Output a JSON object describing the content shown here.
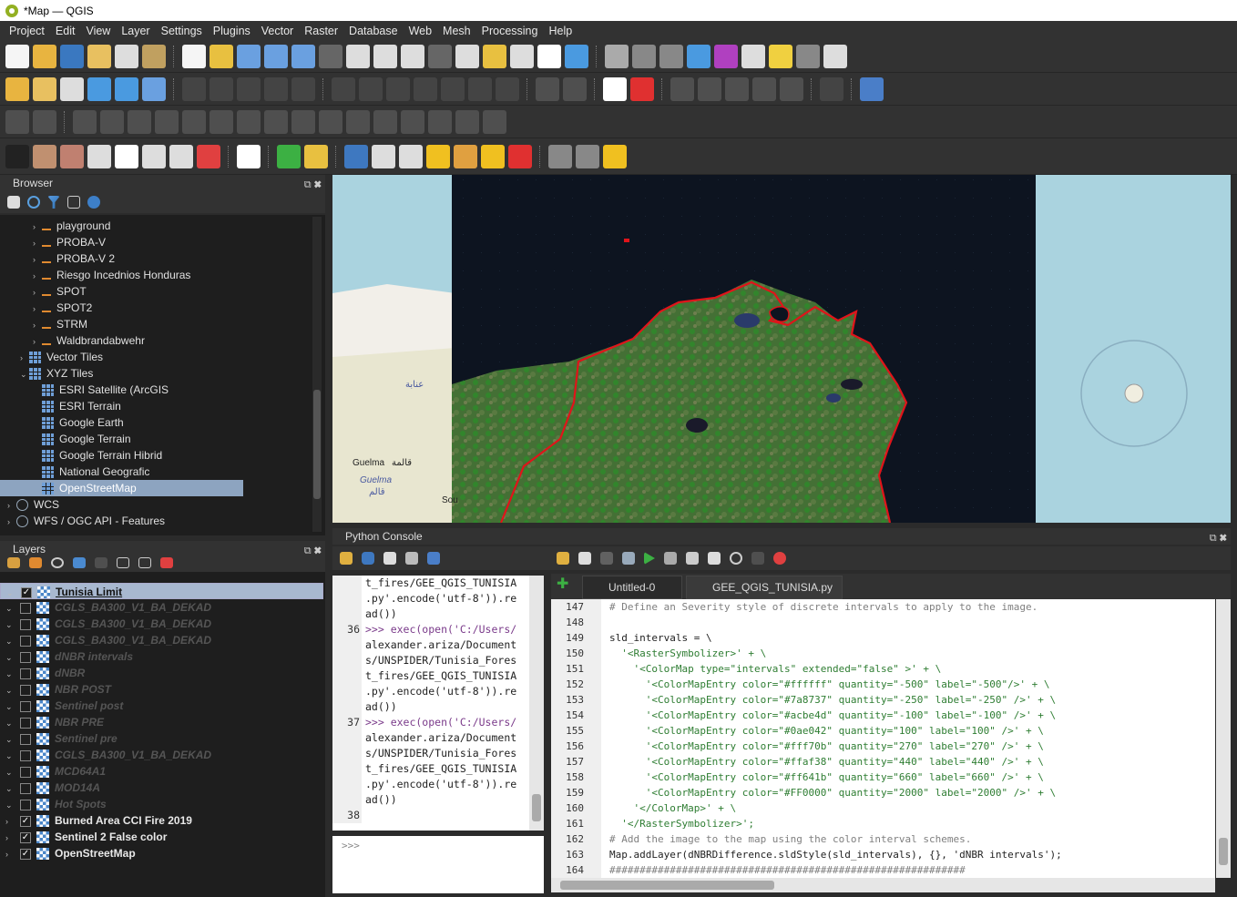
{
  "window": {
    "title": "*Map — QGIS"
  },
  "menu": [
    "Project",
    "Edit",
    "View",
    "Layer",
    "Settings",
    "Plugins",
    "Vector",
    "Raster",
    "Database",
    "Web",
    "Mesh",
    "Processing",
    "Help"
  ],
  "browser": {
    "title": "Browser",
    "items": [
      {
        "label": "playground",
        "kind": "conn",
        "indent": 2
      },
      {
        "label": "PROBA-V",
        "kind": "conn",
        "indent": 2
      },
      {
        "label": "PROBA-V 2",
        "kind": "conn",
        "indent": 2
      },
      {
        "label": "Riesgo Incednios Honduras",
        "kind": "conn",
        "indent": 2
      },
      {
        "label": "SPOT",
        "kind": "conn",
        "indent": 2
      },
      {
        "label": "SPOT2",
        "kind": "conn",
        "indent": 2
      },
      {
        "label": "STRM",
        "kind": "conn",
        "indent": 2
      },
      {
        "label": "Waldbrandabwehr",
        "kind": "conn",
        "indent": 2
      },
      {
        "label": "Vector Tiles",
        "kind": "grid",
        "indent": 1
      },
      {
        "label": "XYZ Tiles",
        "kind": "grid",
        "indent": 1,
        "expanded": true
      },
      {
        "label": "ESRI Satellite (ArcGIS",
        "kind": "grid",
        "indent": 2
      },
      {
        "label": "ESRI Terrain",
        "kind": "grid",
        "indent": 2
      },
      {
        "label": "Google Earth",
        "kind": "grid",
        "indent": 2
      },
      {
        "label": "Google Terrain",
        "kind": "grid",
        "indent": 2
      },
      {
        "label": "Google Terrain Hibrid",
        "kind": "grid",
        "indent": 2
      },
      {
        "label": "National Geografic",
        "kind": "grid",
        "indent": 2
      },
      {
        "label": "OpenStreetMap",
        "kind": "grid",
        "indent": 2,
        "selected": true
      },
      {
        "label": "WCS",
        "kind": "globe",
        "indent": 0
      },
      {
        "label": "WFS / OGC API - Features",
        "kind": "globe",
        "indent": 0
      }
    ]
  },
  "layers": {
    "title": "Layers",
    "items": [
      {
        "label": "Tunisia Limit",
        "checked": true,
        "selected": true,
        "bold": true
      },
      {
        "label": "CGLS_BA300_V1_BA_DEKAD",
        "checked": false
      },
      {
        "label": "CGLS_BA300_V1_BA_DEKAD",
        "checked": false
      },
      {
        "label": "CGLS_BA300_V1_BA_DEKAD",
        "checked": false
      },
      {
        "label": "dNBR intervals",
        "checked": false
      },
      {
        "label": "dNBR",
        "checked": false
      },
      {
        "label": "NBR POST",
        "checked": false
      },
      {
        "label": "Sentinel post",
        "checked": false
      },
      {
        "label": "NBR PRE",
        "checked": false
      },
      {
        "label": "Sentinel pre",
        "checked": false
      },
      {
        "label": "CGLS_BA300_V1_BA_DEKAD",
        "checked": false
      },
      {
        "label": "MCD64A1",
        "checked": false
      },
      {
        "label": "MOD14A",
        "checked": false
      },
      {
        "label": "Hot Spots",
        "checked": false
      },
      {
        "label": "Burned Area CCI Fire 2019",
        "checked": true,
        "bold": true
      },
      {
        "label": "Sentinel 2 False color",
        "checked": true,
        "bold": true
      },
      {
        "label": "OpenStreetMap",
        "checked": true,
        "bold": true
      }
    ]
  },
  "map": {
    "labels": {
      "guelma": "Guelma",
      "guelma_ar": "قالمة",
      "guelma2": "Guelma",
      "guelma2_ar": "قالم",
      "annaba_ar": "عنابة",
      "sou": "Sou"
    }
  },
  "python_console": {
    "title": "Python Console",
    "output": [
      {
        "n": "",
        "t": "t_fires/GEE_QGIS_TUNISIA"
      },
      {
        "n": "",
        "t": ".py'.encode('utf-8')).re"
      },
      {
        "n": "",
        "t": "ad())"
      },
      {
        "n": "36",
        "t": ">>> exec(open('C:/Users/"
      },
      {
        "n": "",
        "t": "alexander.ariza/Document"
      },
      {
        "n": "",
        "t": "s/UNSPIDER/Tunisia_Fores"
      },
      {
        "n": "",
        "t": "t_fires/GEE_QGIS_TUNISIA"
      },
      {
        "n": "",
        "t": ".py'.encode('utf-8')).re"
      },
      {
        "n": "",
        "t": "ad())"
      },
      {
        "n": "37",
        "t": ">>> exec(open('C:/Users/"
      },
      {
        "n": "",
        "t": "alexander.ariza/Document"
      },
      {
        "n": "",
        "t": "s/UNSPIDER/Tunisia_Fores"
      },
      {
        "n": "",
        "t": "t_fires/GEE_QGIS_TUNISIA"
      },
      {
        "n": "",
        "t": ".py'.encode('utf-8')).re"
      },
      {
        "n": "",
        "t": "ad())"
      },
      {
        "n": "38",
        "t": ""
      }
    ],
    "prompt": ">>>",
    "tabs": [
      "Untitled-0",
      "GEE_QGIS_TUNISIA.py"
    ],
    "editor": [
      {
        "n": "147",
        "t": "# Define an Severity style of discrete intervals to apply to the image.",
        "cls": "cm"
      },
      {
        "n": "148",
        "t": "",
        "cls": ""
      },
      {
        "n": "149",
        "t": "sld_intervals = \\",
        "cls": ""
      },
      {
        "n": "150",
        "t": "  '<RasterSymbolizer>' + \\",
        "cls": "st"
      },
      {
        "n": "151",
        "t": "    '<ColorMap type=\"intervals\" extended=\"false\" >' + \\",
        "cls": "st"
      },
      {
        "n": "152",
        "t": "      '<ColorMapEntry color=\"#ffffff\" quantity=\"-500\" label=\"-500\"/>' + \\",
        "cls": "st"
      },
      {
        "n": "153",
        "t": "      '<ColorMapEntry color=\"#7a8737\" quantity=\"-250\" label=\"-250\" />' + \\",
        "cls": "st"
      },
      {
        "n": "154",
        "t": "      '<ColorMapEntry color=\"#acbe4d\" quantity=\"-100\" label=\"-100\" />' + \\",
        "cls": "st"
      },
      {
        "n": "155",
        "t": "      '<ColorMapEntry color=\"#0ae042\" quantity=\"100\" label=\"100\" />' + \\",
        "cls": "st"
      },
      {
        "n": "156",
        "t": "      '<ColorMapEntry color=\"#fff70b\" quantity=\"270\" label=\"270\" />' + \\",
        "cls": "st"
      },
      {
        "n": "157",
        "t": "      '<ColorMapEntry color=\"#ffaf38\" quantity=\"440\" label=\"440\" />' + \\",
        "cls": "st"
      },
      {
        "n": "158",
        "t": "      '<ColorMapEntry color=\"#ff641b\" quantity=\"660\" label=\"660\" />' + \\",
        "cls": "st"
      },
      {
        "n": "159",
        "t": "      '<ColorMapEntry color=\"#FF0000\" quantity=\"2000\" label=\"2000\" />' + \\",
        "cls": "st"
      },
      {
        "n": "160",
        "t": "    '</ColorMap>' + \\",
        "cls": "st"
      },
      {
        "n": "161",
        "t": "  '</RasterSymbolizer>';",
        "cls": "st"
      },
      {
        "n": "162",
        "t": "# Add the image to the map using the color interval schemes.",
        "cls": "cm"
      },
      {
        "n": "163",
        "t": "Map.addLayer(dNBRDifference.sldStyle(sld_intervals), {}, 'dNBR intervals');",
        "cls": ""
      },
      {
        "n": "164",
        "t": "###########################################################",
        "cls": "cm"
      }
    ]
  }
}
